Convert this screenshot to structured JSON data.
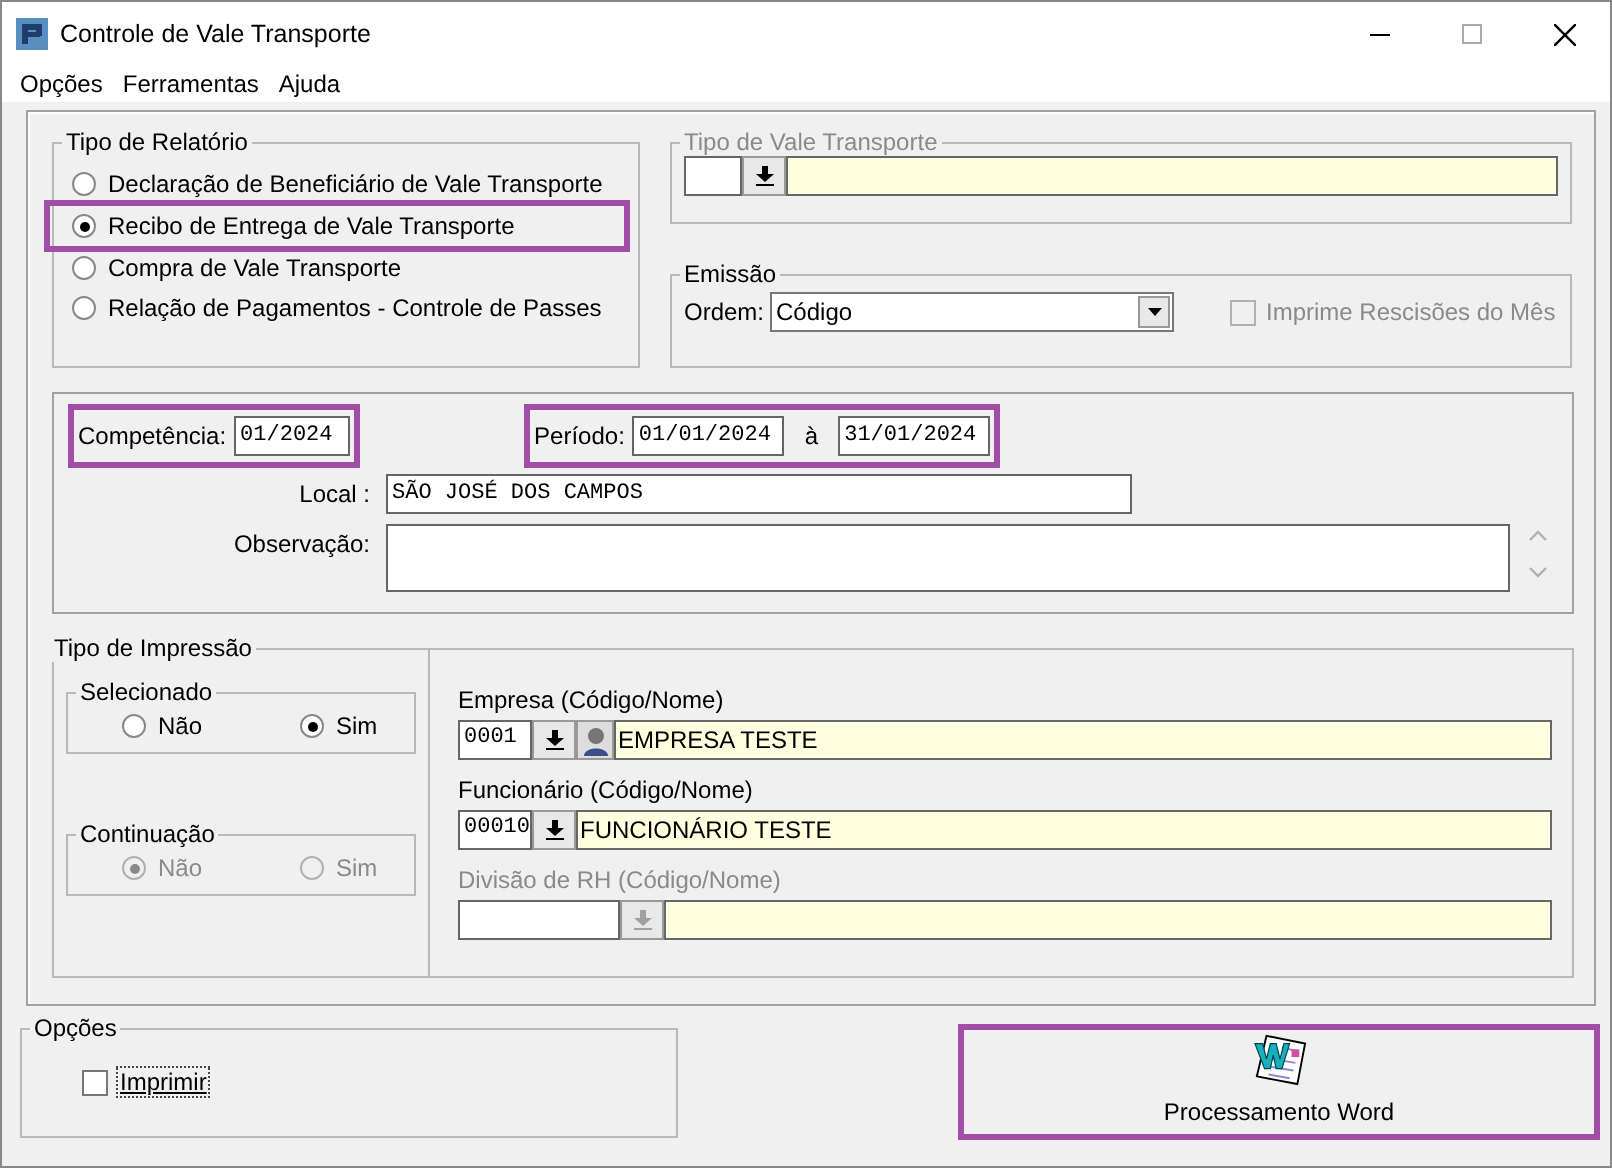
{
  "window": {
    "title": "Controle de Vale Transporte"
  },
  "menu": [
    "Opções",
    "Ferramentas",
    "Ajuda"
  ],
  "report_type": {
    "label": "Tipo de Relatório",
    "options": [
      {
        "label": "Declaração de Beneficiário de Vale Transporte",
        "selected": false,
        "highlighted": false
      },
      {
        "label": "Recibo de Entrega de Vale Transporte",
        "selected": true,
        "highlighted": true
      },
      {
        "label": "Compra de Vale Transporte",
        "selected": false,
        "highlighted": false
      },
      {
        "label": "Relação de Pagamentos - Controle de Passes",
        "selected": false,
        "highlighted": false
      }
    ]
  },
  "voucher_type": {
    "label": "Tipo de Vale Transporte",
    "disabled": true
  },
  "emission": {
    "label": "Emissão",
    "order_label": "Ordem:",
    "order_value": "Código",
    "terminations": {
      "label": "Imprime Rescisões do Mês",
      "checked": false,
      "disabled": true
    }
  },
  "period": {
    "competence_label": "Competência:",
    "competence_value": "01/2024",
    "competence_highlighted": true,
    "period_label": "Período:",
    "start": "01/01/2024",
    "between": "à",
    "end": "31/01/2024",
    "period_highlighted": true,
    "local_label": "Local :",
    "local_value": "SÃO JOSÉ DOS CAMPOS",
    "note_label": "Observação:"
  },
  "print_type": {
    "label": "Tipo de Impressão",
    "groups": [
      {
        "label": "Selecionado",
        "disabled": false,
        "options": [
          {
            "label": "Não",
            "selected": false
          },
          {
            "label": "Sim",
            "selected": true
          }
        ]
      },
      {
        "label": "Continuação",
        "disabled": true,
        "options": [
          {
            "label": "Não",
            "selected": true
          },
          {
            "label": "Sim",
            "selected": false
          }
        ]
      }
    ],
    "lookups": [
      {
        "label": "Empresa (Código/Nome)",
        "kind": "short",
        "code": "0001",
        "name": "EMPRESA TESTE",
        "disabled": false,
        "person_button": true
      },
      {
        "label": "Funcionário (Código/Nome)",
        "kind": "short",
        "code": "00010",
        "name": "FUNCIONÁRIO TESTE",
        "disabled": false,
        "person_button": false
      },
      {
        "label": "Divisão de RH (Código/Nome)",
        "kind": "long",
        "disabled": true,
        "person_button": false
      }
    ]
  },
  "options": {
    "label": "Opções",
    "print": {
      "label": "Imprimir",
      "checked": false
    }
  },
  "word_button": {
    "label": "Processamento Word",
    "highlighted": true
  }
}
